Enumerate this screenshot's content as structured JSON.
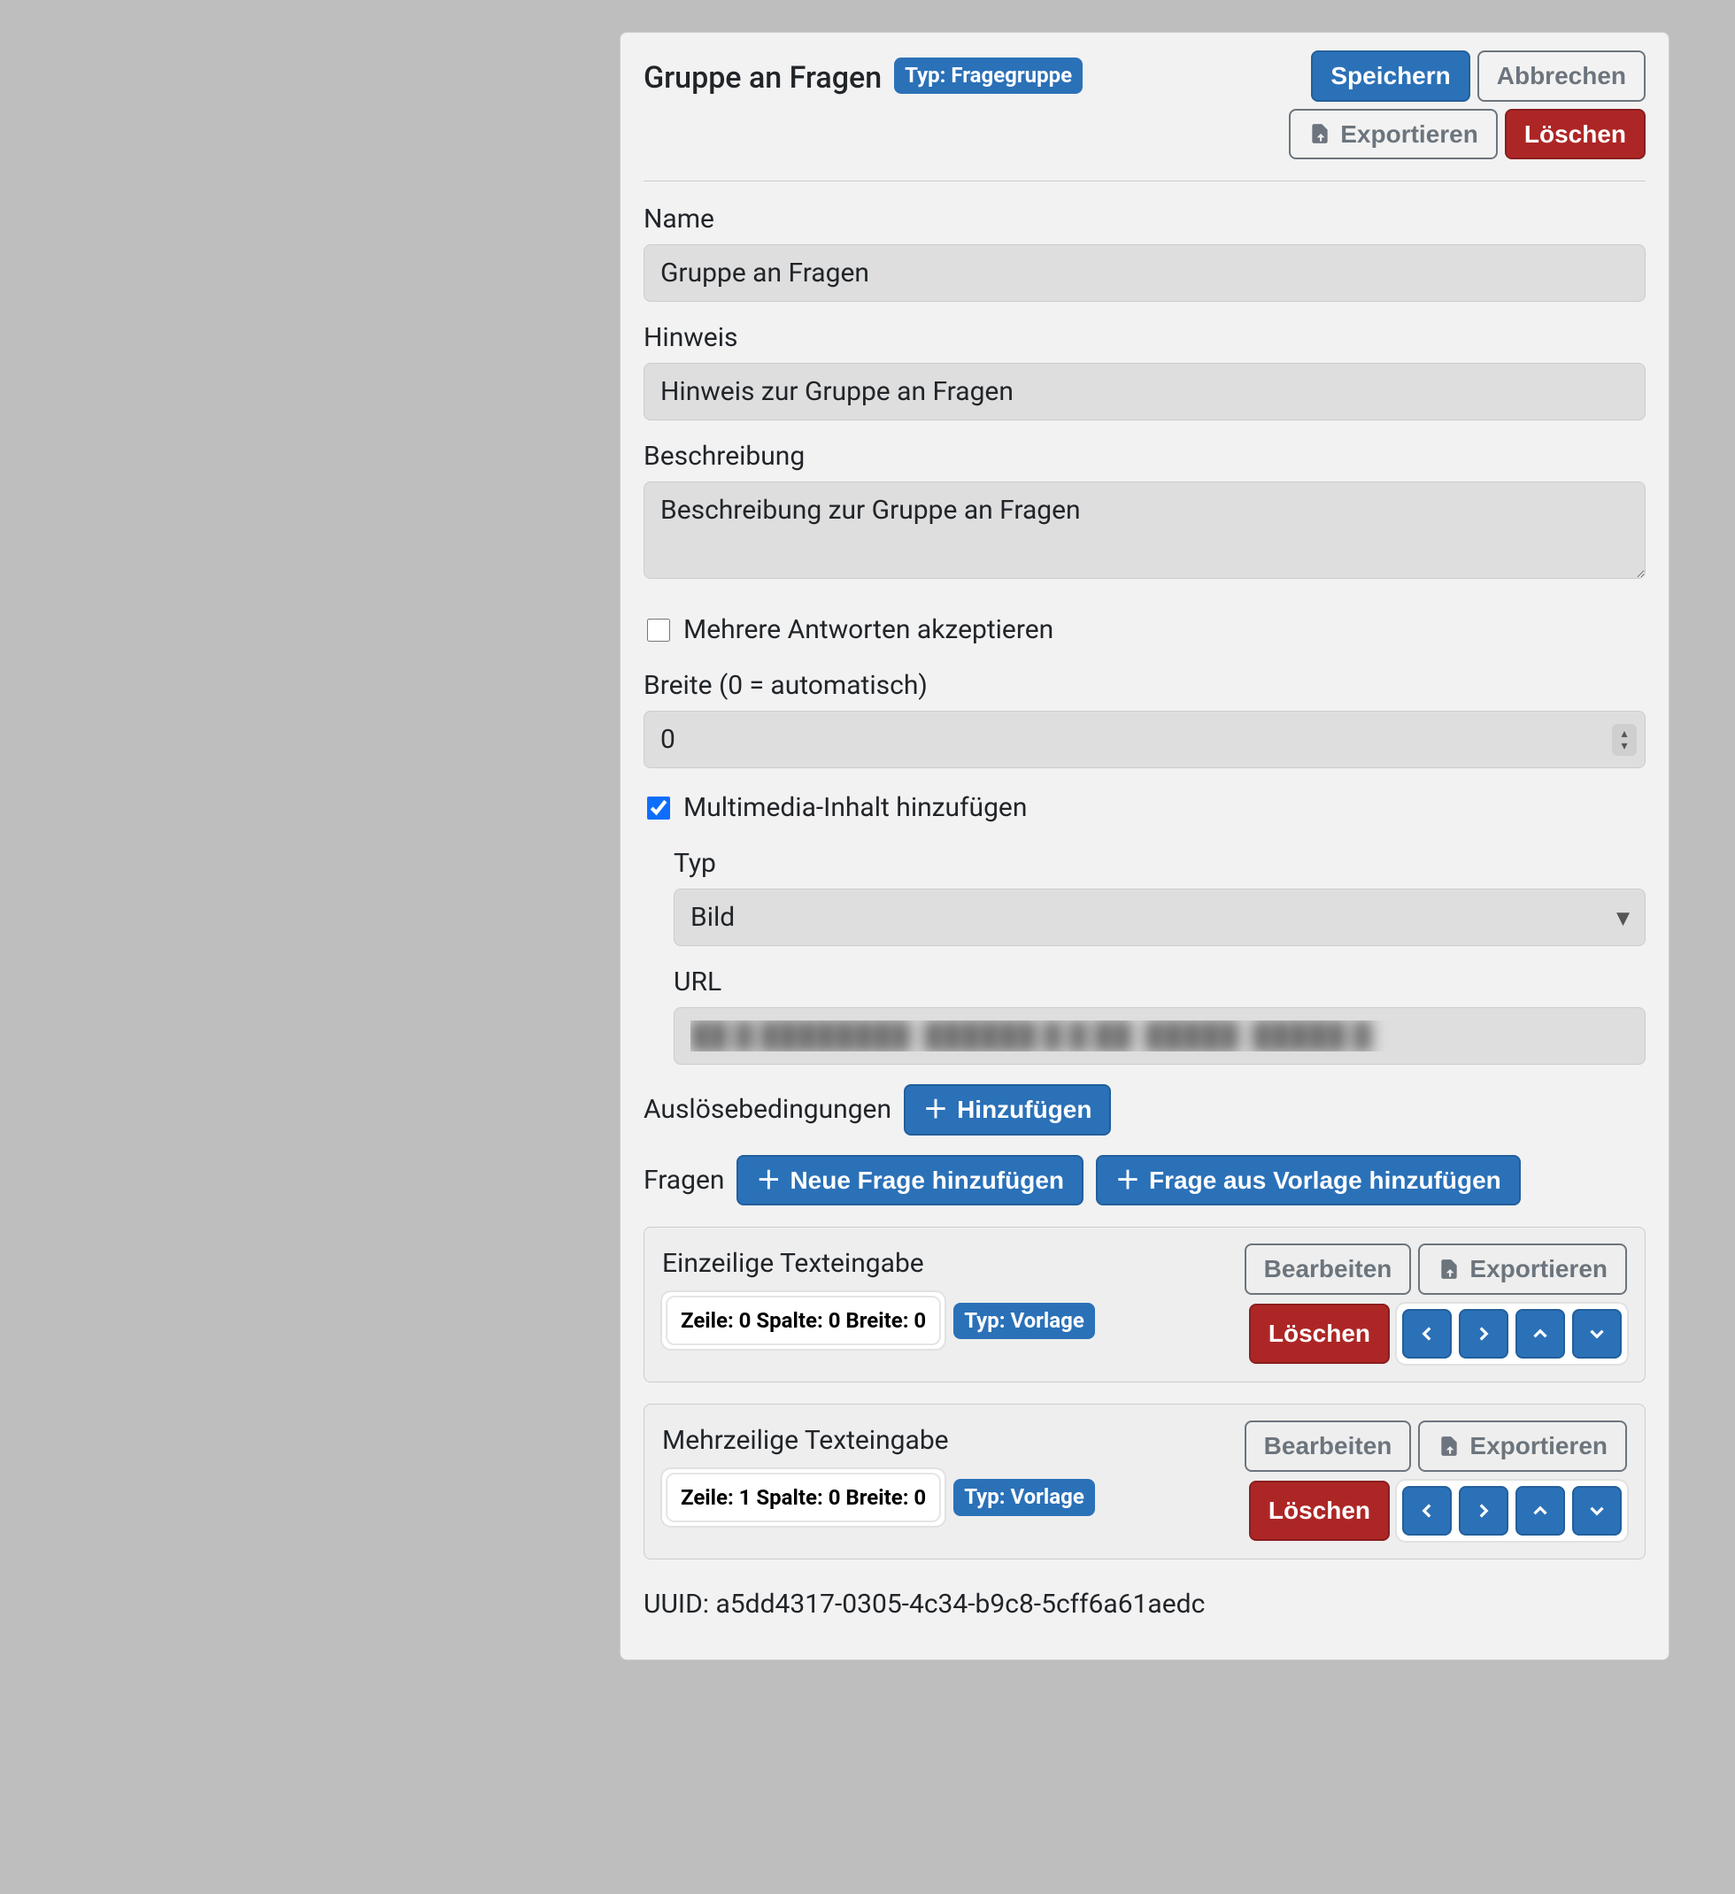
{
  "header": {
    "title": "Gruppe an Fragen",
    "type_badge": "Typ: Fragegruppe",
    "buttons": {
      "save": "Speichern",
      "cancel": "Abbrechen",
      "export": "Exportieren",
      "delete": "Löschen"
    }
  },
  "fields": {
    "name": {
      "label": "Name",
      "value": "Gruppe an Fragen"
    },
    "hint": {
      "label": "Hinweis",
      "value": "Hinweis zur Gruppe an Fragen"
    },
    "description": {
      "label": "Beschreibung",
      "value": "Beschreibung zur Gruppe an Fragen"
    },
    "accept_multiple": {
      "label": "Mehrere Antworten akzeptieren",
      "checked": false
    },
    "width": {
      "label": "Breite (0 = automatisch)",
      "value": "0"
    },
    "add_multimedia": {
      "label": "Multimedia-Inhalt hinzufügen",
      "checked": true
    },
    "media_type": {
      "label": "Typ",
      "value": "Bild"
    },
    "media_url": {
      "label": "URL",
      "value": "██ █ ████████  ██████ █ █ ██  █████  █████ █"
    }
  },
  "triggers": {
    "label": "Auslösebedingungen",
    "add": "Hinzufügen"
  },
  "questions": {
    "label": "Fragen",
    "add_new": "Neue Frage hinzufügen",
    "add_from_template": "Frage aus Vorlage hinzufügen",
    "items": [
      {
        "title": "Einzeilige Texteingabe",
        "pos_badge": "Zeile: 0 Spalte: 0 Breite: 0",
        "type_badge": "Typ: Vorlage"
      },
      {
        "title": "Mehrzeilige Texteingabe",
        "pos_badge": "Zeile: 1 Spalte: 0 Breite: 0",
        "type_badge": "Typ: Vorlage"
      }
    ],
    "item_buttons": {
      "edit": "Bearbeiten",
      "export": "Exportieren",
      "delete": "Löschen"
    }
  },
  "uuid": {
    "label": "UUID:",
    "value": "a5dd4317-0305-4c34-b9c8-5cff6a61aedc"
  }
}
